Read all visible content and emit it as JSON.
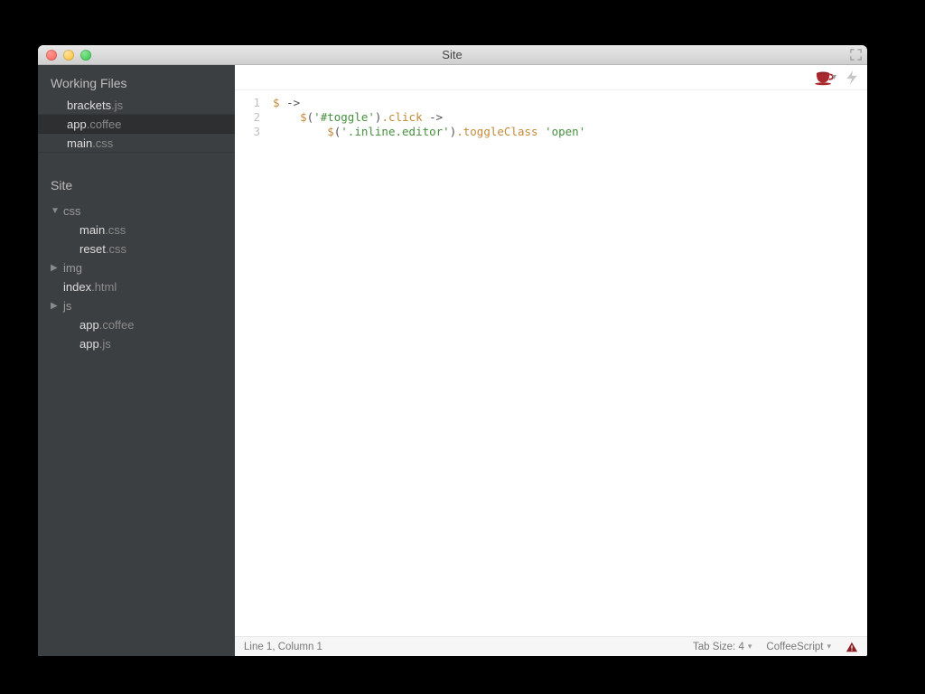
{
  "window": {
    "title": "Site"
  },
  "sidebar": {
    "working_files_label": "Working Files",
    "working_files": [
      {
        "base": "brackets",
        "ext": ".js",
        "selected": false
      },
      {
        "base": "app",
        "ext": ".coffee",
        "selected": true
      },
      {
        "base": "main",
        "ext": ".css",
        "selected": false
      }
    ],
    "project_label": "Site",
    "tree": [
      {
        "depth": 0,
        "twisty": "▼",
        "is_folder": true,
        "base": "css",
        "ext": ""
      },
      {
        "depth": 1,
        "twisty": "",
        "is_folder": false,
        "base": "main",
        "ext": ".css"
      },
      {
        "depth": 1,
        "twisty": "",
        "is_folder": false,
        "base": "reset",
        "ext": ".css"
      },
      {
        "depth": 0,
        "twisty": "▶",
        "is_folder": true,
        "base": "img",
        "ext": ""
      },
      {
        "depth": 0,
        "twisty": "",
        "is_folder": false,
        "base": "index",
        "ext": ".html"
      },
      {
        "depth": 0,
        "twisty": "▶",
        "is_folder": true,
        "base": "js",
        "ext": ""
      },
      {
        "depth": 1,
        "twisty": "",
        "is_folder": false,
        "base": "app",
        "ext": ".coffee"
      },
      {
        "depth": 1,
        "twisty": "",
        "is_folder": false,
        "base": "app",
        "ext": ".js"
      }
    ]
  },
  "editor": {
    "lines": [
      [
        {
          "cls": "tok-kw",
          "text": "$ "
        },
        {
          "cls": "tok-plain",
          "text": "->"
        }
      ],
      [
        {
          "cls": "tok-plain",
          "text": "    "
        },
        {
          "cls": "tok-kw",
          "text": "$"
        },
        {
          "cls": "tok-plain",
          "text": "("
        },
        {
          "cls": "tok-str",
          "text": "'#toggle'"
        },
        {
          "cls": "tok-plain",
          "text": ")"
        },
        {
          "cls": "tok-kw",
          "text": ".click "
        },
        {
          "cls": "tok-plain",
          "text": "->"
        }
      ],
      [
        {
          "cls": "tok-plain",
          "text": "        "
        },
        {
          "cls": "tok-kw",
          "text": "$"
        },
        {
          "cls": "tok-plain",
          "text": "("
        },
        {
          "cls": "tok-str",
          "text": "'.inline.editor'"
        },
        {
          "cls": "tok-plain",
          "text": ")"
        },
        {
          "cls": "tok-kw",
          "text": ".toggleClass "
        },
        {
          "cls": "tok-str",
          "text": "'open'"
        }
      ]
    ]
  },
  "statusbar": {
    "cursor": "Line 1, Column 1",
    "tabsize_label": "Tab Size: 4",
    "language_label": "CoffeeScript"
  }
}
